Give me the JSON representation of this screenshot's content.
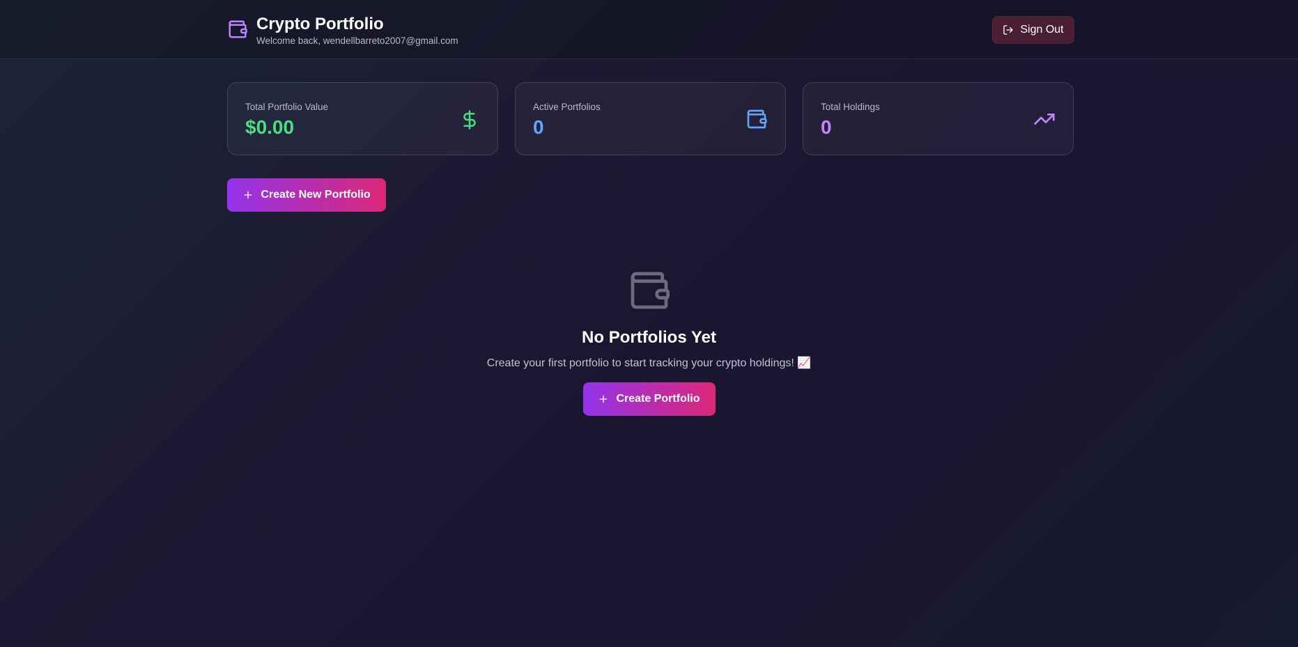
{
  "header": {
    "title": "Crypto Portfolio",
    "welcome": "Welcome back, wendellbarreto2007@gmail.com",
    "icon": "wallet-icon",
    "sign_out_label": "Sign Out",
    "sign_out_icon": "log-out-icon"
  },
  "stats": [
    {
      "label": "Total Portfolio Value",
      "value": "$0.00",
      "color": "#4ade80",
      "icon": "dollar-icon"
    },
    {
      "label": "Active Portfolios",
      "value": "0",
      "color": "#60a5fa",
      "icon": "wallet-icon"
    },
    {
      "label": "Total Holdings",
      "value": "0",
      "color": "#c084fc",
      "icon": "trending-up-icon"
    }
  ],
  "actions": {
    "create_new_label": "Create New Portfolio"
  },
  "empty_state": {
    "icon": "wallet-icon",
    "title": "No Portfolios Yet",
    "description": "Create your first portfolio to start tracking your crypto holdings! 📈",
    "button_label": "Create Portfolio"
  },
  "colors": {
    "accent_purple": "#9333ea",
    "accent_pink": "#db2777",
    "sign_out_bg": "#4a1e33"
  }
}
